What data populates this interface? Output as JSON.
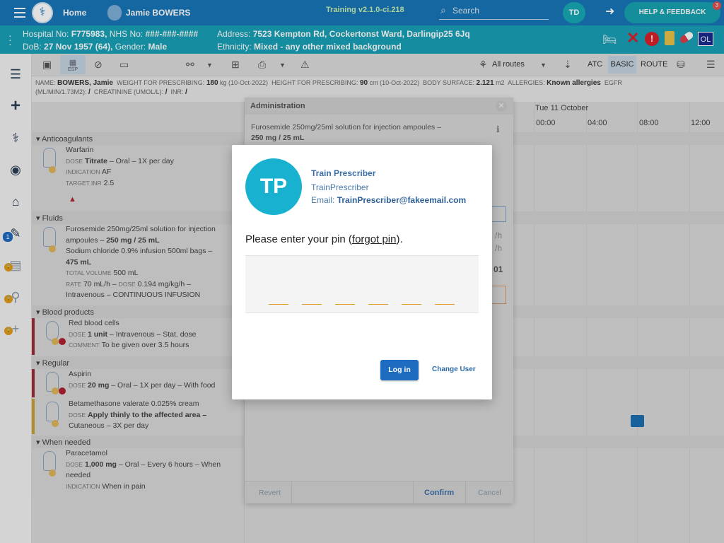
{
  "topbar": {
    "home_label": "Home",
    "user_name": "Jamie BOWERS",
    "version": "Training v2.1.0-ci.218",
    "search_placeholder": "Search",
    "user_initials": "TD",
    "help_label": "HELP & FEEDBACK",
    "notification_count": "3"
  },
  "patient": {
    "hospital_label": "Hospital No:",
    "hospital_no": "F775983,",
    "nhs_label": "NHS No:",
    "nhs_no": "###-###-####",
    "address_label": "Address:",
    "address": "7523 Kempton Rd, Cockertonst Ward, Darlingip25 6Jq",
    "dob_label": "DoB:",
    "dob": "27 Nov 1957 (64),",
    "gender_label": "Gender:",
    "gender": "Male",
    "ethnicity_label": "Ethnicity:",
    "ethnicity": "Mixed - any other mixed background",
    "ol_badge": "OL"
  },
  "toolbar": {
    "esp_label": "ESP",
    "all_routes": "All routes",
    "atc": "ATC",
    "basic": "BASIC",
    "route": "ROUTE"
  },
  "infobar": {
    "name_label": "NAME:",
    "name": "BOWERS, Jamie",
    "weight_label": "WEIGHT FOR PRESCRIBING:",
    "weight": "180",
    "weight_unit": "kg (10-Oct-2022)",
    "height_label": "HEIGHT FOR PRESCRIBING:",
    "height": "90",
    "height_unit": "cm (10-Oct-2022)",
    "bsa_label": "BODY SURFACE:",
    "bsa": "2.121",
    "bsa_unit": "m2",
    "allergies_label": "ALLERGIES:",
    "allergies": "Known allergies",
    "egfr_label": "EGFR",
    "egfr_unit": "(ML/MIN/1.73M2):",
    "egfr": "/",
    "creat_label": "CREATININE (UMOL/L):",
    "creat": "/",
    "inr_label": "INR:",
    "inr": "/"
  },
  "timeline": {
    "date": "Tue 11 October",
    "times": [
      "00:00",
      "04:00",
      "08:00",
      "12:00"
    ]
  },
  "sections": {
    "anticoag": "Anticoagulants",
    "fluids": "Fluids",
    "blood": "Blood products",
    "regular": "Regular",
    "when_needed": "When needed"
  },
  "meds": {
    "warfarin": {
      "name": "Warfarin",
      "dose_lbl": "DOSE",
      "dose": "Titrate",
      "rest": "– Oral – 1X per day",
      "ind_lbl": "INDICATION",
      "ind": "AF",
      "inr_lbl": "TARGET INR",
      "inr": "2.5"
    },
    "furosemide": {
      "l1": "Furosemide 250mg/25ml solution for injection",
      "l2a": "ampoules –",
      "l2b": "250 mg / 25 mL",
      "l3": "Sodium chloride 0.9% infusion 500ml bags –",
      "l4": "475 mL",
      "tv_lbl": "TOTAL VOLUME",
      "tv": "500 mL",
      "rate_lbl": "RATE",
      "rate": "70 mL/h –",
      "dose_lbl": "DOSE",
      "dose": "0.194 mg/kg/h –",
      "l7": "Intravenous – CONTINUOUS INFUSION"
    },
    "rbc": {
      "name": "Red blood cells",
      "dose_lbl": "DOSE",
      "dose": "1 unit",
      "rest": "– Intravenous – Stat. dose",
      "cmt_lbl": "COMMENT",
      "cmt": "To be given over 3.5 hours"
    },
    "aspirin": {
      "name": "Aspirin",
      "dose_lbl": "DOSE",
      "dose": "20 mg",
      "rest": "– Oral – 1X per day – With food"
    },
    "betamethasone": {
      "name": "Betamethasone valerate 0.025% cream",
      "dose_lbl": "DOSE",
      "dose": "Apply thinly to the affected area –",
      "l3": "Cutaneous – 3X per day"
    },
    "paracetamol": {
      "name": "Paracetamol",
      "dose_lbl": "DOSE",
      "dose": "1,000 mg",
      "rest": "– Oral – Every 6 hours – When",
      "rest2": "needed",
      "ind_lbl": "INDICATION",
      "ind": "When in pain"
    }
  },
  "admin": {
    "title": "Administration",
    "drug_l1": "Furosemide 250mg/25ml solution for injection ampoules –",
    "drug_l2": "250 mg / 25 mL",
    "frag1": "/h",
    "frag2": "/h",
    "frag3": "01",
    "revert": "Revert",
    "confirm": "Confirm",
    "cancel": "Cancel"
  },
  "pin_modal": {
    "initials": "TP",
    "display_name": "Train Prescriber",
    "user_id": "TrainPrescriber",
    "email_label": "Email:",
    "email": "TrainPrescriber@fakeemail.com",
    "prompt": "Please enter your pin (",
    "forgot": "forgot pin",
    "prompt_end": ").",
    "login": "Log in",
    "change_user": "Change User",
    "pin_slots": 6
  },
  "colors": {
    "topbar": "#1976b8",
    "patient_bar": "#18a0b5",
    "avatar": "#18b2d0",
    "login": "#1e6cc0",
    "pin_underline": "#e39b2b"
  }
}
